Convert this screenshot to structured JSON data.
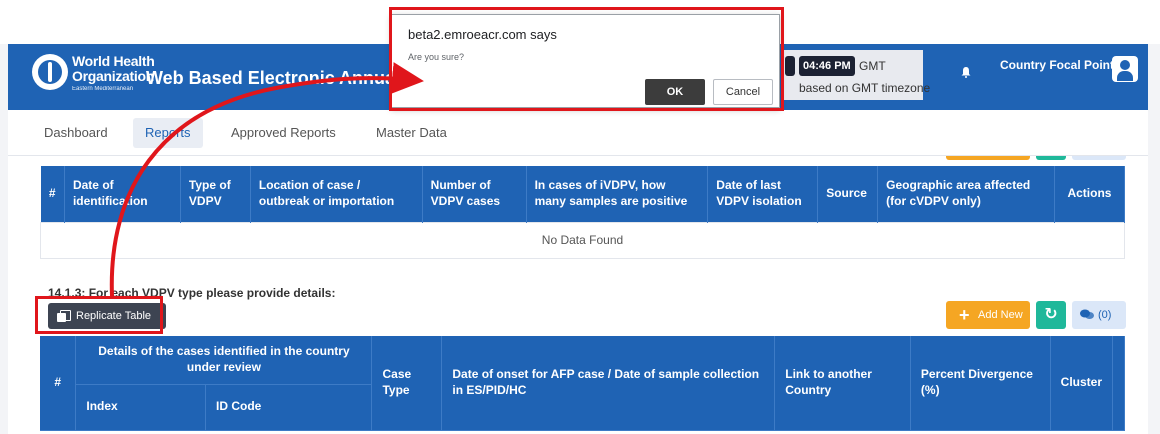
{
  "header": {
    "org_line1": "World Health",
    "org_line2": "Organization",
    "org_line3": "Eastern Mediterranean",
    "app_title": "Web Based Electronic Annual Certification",
    "clock_time": "04:46 PM",
    "clock_tz": "GMT",
    "clock_note": "based on GMT timezone",
    "user_role": "Country Focal Point"
  },
  "nav": {
    "items": [
      {
        "label": "Dashboard"
      },
      {
        "label": "Reports"
      },
      {
        "label": "Approved Reports"
      },
      {
        "label": "Master Data"
      }
    ],
    "active": "Reports"
  },
  "table1": {
    "columns": [
      "#",
      "Date of identification",
      "Type of VDPV",
      "Location of case / outbreak or importation",
      "Number of VDPV cases",
      "In cases of iVDPV, how many samples are positive",
      "Date of last VDPV isolation",
      "Source",
      "Geographic area affected (for cVDPV only)",
      "Actions"
    ],
    "empty_text": "No Data Found"
  },
  "section": {
    "label": "14.1.3: For each VDPV type please provide details:"
  },
  "toolbar": {
    "replicate_label": "Replicate Table",
    "add_new_label": "Add New",
    "comments_label": "(0)"
  },
  "table2": {
    "group_header": "Details of the cases identified in the country under review",
    "col_hash": "#",
    "sub_index": "Index",
    "sub_id": "ID Code",
    "col_case_type": "Case Type",
    "col_onset": "Date of onset for AFP case / Date of sample collection in ES/PID/HC",
    "col_link": "Link to another Country",
    "col_percent": "Percent Divergence (%)",
    "col_cluster": "Cluster"
  },
  "dialog": {
    "title": "beta2.emroeacr.com says",
    "message": "Are you sure?",
    "ok_label": "OK",
    "cancel_label": "Cancel"
  },
  "colors": {
    "primary": "#1f63b4",
    "annotation": "#e0161b",
    "add_new": "#f5a623",
    "refresh": "#1fb89a"
  }
}
